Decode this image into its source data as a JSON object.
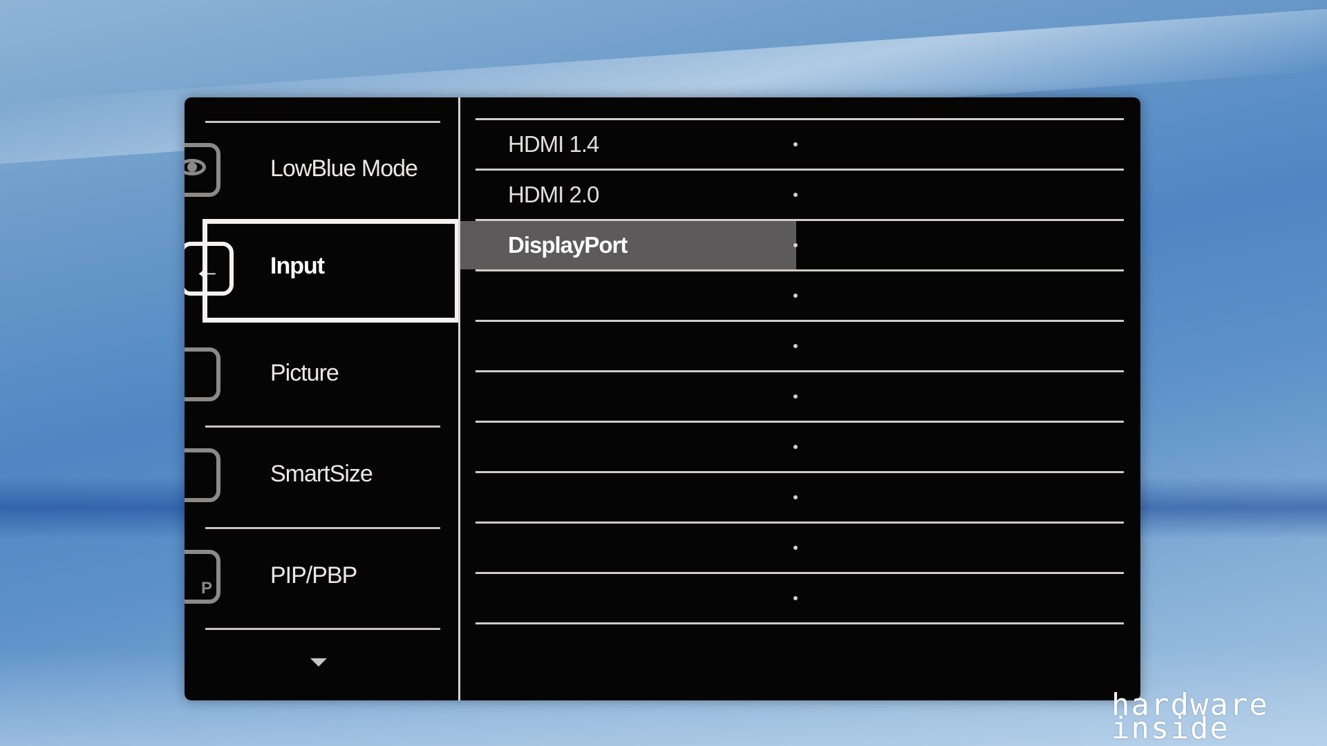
{
  "osd_menu": {
    "items": [
      {
        "label": "LowBlue Mode",
        "icon": "eye-icon"
      },
      {
        "label": "Input",
        "icon": "input-arrow-icon",
        "selected": true
      },
      {
        "label": "Picture",
        "icon": "picture-icon"
      },
      {
        "label": "SmartSize",
        "icon": "smartsize-icon"
      },
      {
        "label": "PIP/PBP",
        "icon": "pip-icon",
        "icon_text": "P"
      }
    ],
    "more_indicator": "chevron-down-icon"
  },
  "input_options": {
    "items": [
      {
        "label": "HDMI 1.4"
      },
      {
        "label": "HDMI 2.0"
      },
      {
        "label": "DisplayPort",
        "highlighted": true
      },
      {
        "label": ""
      },
      {
        "label": ""
      },
      {
        "label": ""
      },
      {
        "label": ""
      },
      {
        "label": ""
      },
      {
        "label": ""
      },
      {
        "label": ""
      }
    ]
  },
  "watermark": {
    "line1": "hardware",
    "line2": "inside"
  },
  "colors": {
    "panel_bg": "#050505",
    "selection_border": "#f4f1f0",
    "highlight_bg": "#5c5a5b",
    "rule": "#d1cccb",
    "wallpaper_blue": "#4f86c3"
  }
}
